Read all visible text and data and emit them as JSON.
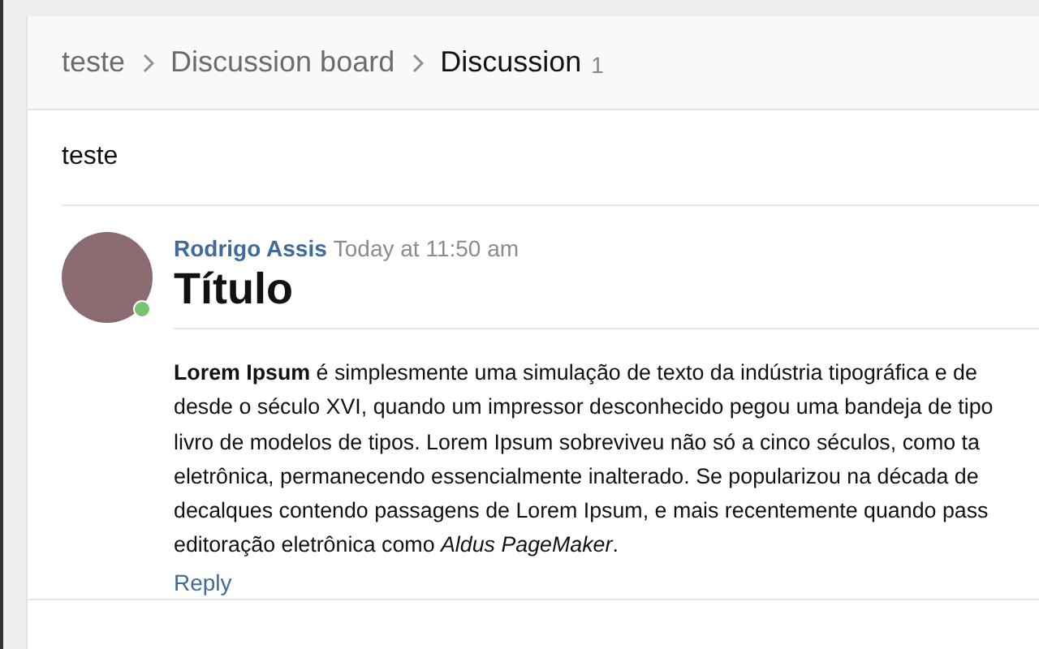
{
  "breadcrumb": [
    {
      "label": "teste",
      "current": false
    },
    {
      "label": "Discussion board",
      "current": false
    },
    {
      "label": "Discussion",
      "current": true,
      "count": "1"
    }
  ],
  "topic": {
    "title": "teste"
  },
  "post": {
    "author": "Rodrigo Assis",
    "time": "Today at 11:50 am",
    "online": true,
    "title": "Título",
    "body_lines": [
      "**Lorem Ipsum** é simplesmente uma simulação de texto da indústria tipográfica e de",
      "desde o século XVI, quando um impressor desconhecido pegou uma bandeja de tipo",
      "livro de modelos de tipos. Lorem Ipsum sobreviveu não só a cinco séculos, como ta",
      "eletrônica, permanecendo essencialmente inalterado. Se popularizou na década de",
      "decalques contendo passagens de Lorem Ipsum, e mais recentemente quando pass",
      "editoração eletrônica como *Aldus PageMaker*."
    ],
    "reply": "Reply"
  }
}
